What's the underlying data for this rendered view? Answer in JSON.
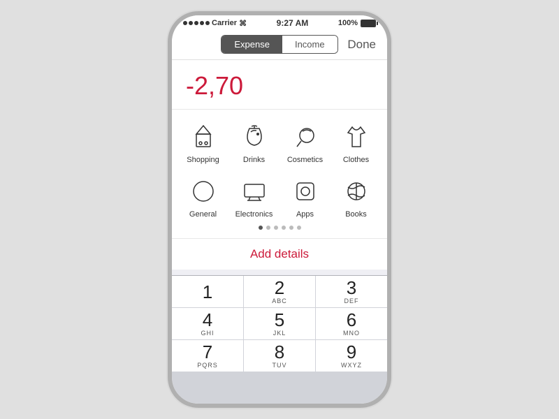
{
  "statusBar": {
    "carrier": "Carrier",
    "wifi": "📶",
    "time": "9:27 AM",
    "battery": "100%"
  },
  "navBar": {
    "expenseLabel": "Expense",
    "incomeLabel": "Income",
    "doneLabel": "Done"
  },
  "amount": {
    "value": "-2,70"
  },
  "categories": [
    {
      "id": "shopping",
      "label": "Shopping"
    },
    {
      "id": "drinks",
      "label": "Drinks"
    },
    {
      "id": "cosmetics",
      "label": "Cosmetics"
    },
    {
      "id": "clothes",
      "label": "Clothes"
    },
    {
      "id": "general",
      "label": "General"
    },
    {
      "id": "electronics",
      "label": "Electronics"
    },
    {
      "id": "apps",
      "label": "Apps"
    },
    {
      "id": "books",
      "label": "Books"
    }
  ],
  "pageIndicators": [
    1,
    2,
    3,
    4,
    5,
    6
  ],
  "addDetails": {
    "label": "Add details"
  },
  "numpad": [
    {
      "main": "1",
      "sub": ""
    },
    {
      "main": "2",
      "sub": "ABC"
    },
    {
      "main": "3",
      "sub": "DEF"
    },
    {
      "main": "4",
      "sub": "GHI"
    },
    {
      "main": "5",
      "sub": "JKL"
    },
    {
      "main": "6",
      "sub": "MNO"
    },
    {
      "main": "7",
      "sub": "PQRS"
    },
    {
      "main": "8",
      "sub": "TUV"
    },
    {
      "main": "9",
      "sub": "WXYZ"
    }
  ]
}
